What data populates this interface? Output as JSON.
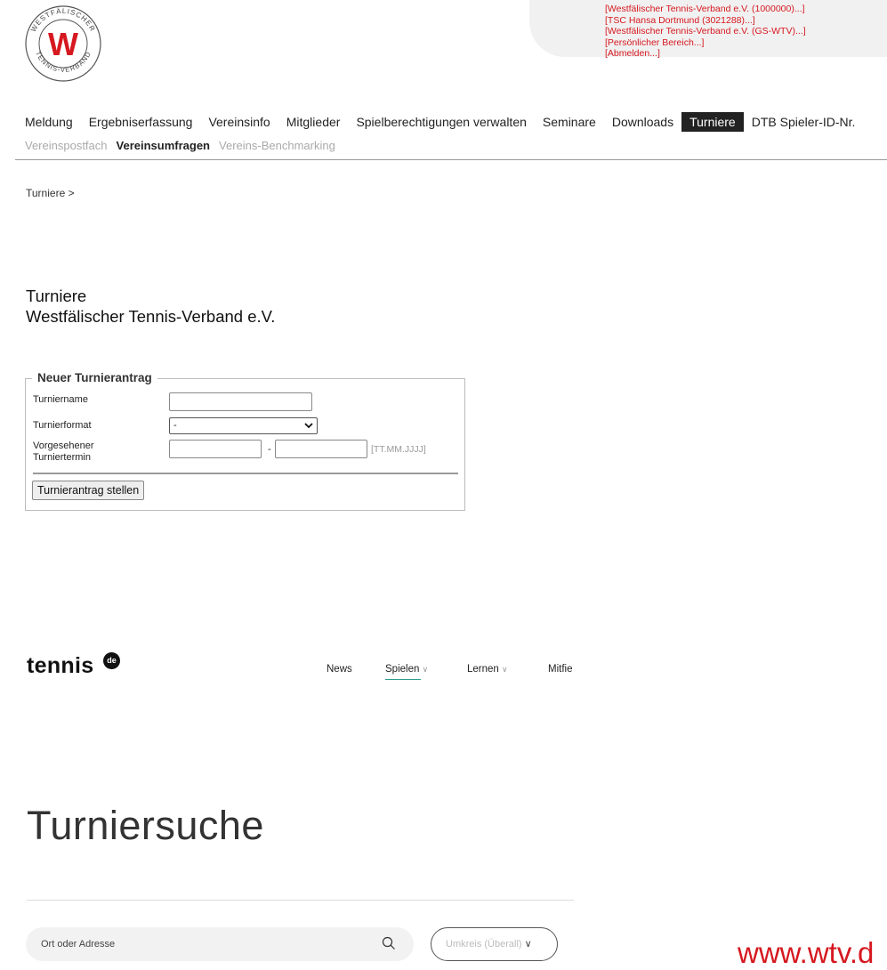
{
  "logo": {
    "ring_text_top": "WESTFÄLISCHER",
    "ring_text_bottom": "TENNIS-VERBAND",
    "monogram": "W",
    "brand_color": "#d6181f"
  },
  "account_links": [
    "[Westfälischer Tennis-Verband e.V. (1000000)...]",
    "[TSC Hansa Dortmund (3021288)...]",
    "[Westfälischer Tennis-Verband e.V. (GS-WTV)...]",
    "[Persönlicher Bereich...]",
    "[Abmelden...]"
  ],
  "main_nav": [
    "Meldung",
    "Ergebniserfassung",
    "Vereinsinfo",
    "Mitglieder",
    "Spielberechtigungen verwalten",
    "Seminare",
    "Downloads",
    "Turniere",
    "DTB Spieler-ID-Nr."
  ],
  "main_nav_active": "Turniere",
  "sub_nav": [
    "Vereinspostfach",
    "Vereinsumfragen",
    "Vereins-Benchmarking"
  ],
  "sub_nav_bold": "Vereinsumfragen",
  "breadcrumb": "Turniere >",
  "page_title": {
    "line1": "Turniere",
    "line2": "Westfälischer Tennis-Verband e.V."
  },
  "form": {
    "legend": "Neuer Turnierantrag",
    "name_label": "Turniername",
    "name_value": "",
    "format_label": "Turnierformat",
    "format_selected": "-",
    "date_label": "Vorgesehener Turniertermin",
    "date_from": "",
    "date_to": "",
    "date_separator": "-",
    "date_hint": "[TT.MM.JJJJ]",
    "submit_label": "Turnierantrag stellen"
  },
  "tennis_de": {
    "logo_text": "tennis",
    "logo_badge": "de",
    "nav": [
      {
        "label": "News",
        "chevron": false
      },
      {
        "label": "Spielen",
        "chevron": true
      },
      {
        "label": "Lernen",
        "chevron": true
      },
      {
        "label": "Mitfie",
        "chevron": false
      }
    ],
    "accent_color": "#2a9d8f",
    "search_title": "Turniersuche",
    "search_placeholder": "Ort oder Adresse",
    "radius_label": "Umkreis (Überall)"
  },
  "footer_url": "www.wtv.d"
}
